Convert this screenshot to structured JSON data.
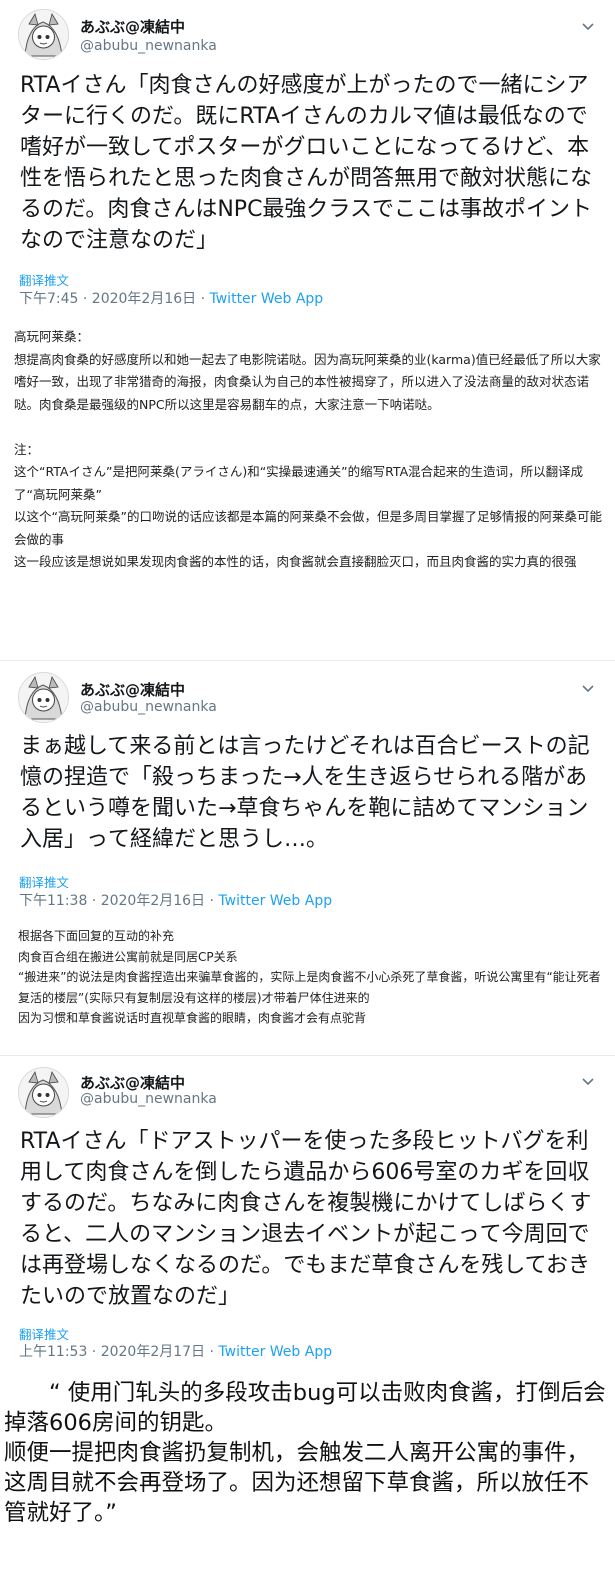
{
  "tweets": [
    {
      "display_name": "あぶぶ@凍結中",
      "handle": "@abubu_newnanka",
      "text": "RTAイさん「肉食さんの好感度が上がったので一緒にシアターに行くのだ。既にRTAイさんのカルマ値は最低なので嗜好が一致してポスターがグロいことになってるけど、本性を悟られたと思った肉食さんが問答無用で敵対状態になるのだ。肉食さんはNPC最強クラスでここは事故ポイントなので注意なのだ」",
      "translate_label": "翻译推文",
      "timestamp": "下午7:45 · 2020年2月16日",
      "separator": " · ",
      "app": "Twitter Web App"
    },
    {
      "display_name": "あぶぶ@凍結中",
      "handle": "@abubu_newnanka",
      "text": "まぁ越して来る前とは言ったけどそれは百合ビーストの記憶の捏造で「殺っちまった→人を生き返らせられる階があるという噂を聞いた→草食ちゃんを鞄に詰めてマンション入居」って経緯だと思うし…。",
      "translate_label": "翻译推文",
      "timestamp": "下午11:38 · 2020年2月16日",
      "separator": " · ",
      "app": "Twitter Web App"
    },
    {
      "display_name": "あぶぶ@凍結中",
      "handle": "@abubu_newnanka",
      "text": "RTAイさん「ドアストッパーを使った多段ヒットバグを利用して肉食さんを倒したら遺品から606号室のカギを回収するのだ。ちなみに肉食さんを複製機にかけてしばらくすると、二人のマンション退去イベントが起こって今周回では再登場しなくなるのだ。でもまだ草食さんを残しておきたいので放置なのだ」",
      "translate_label": "翻译推文",
      "timestamp": "上午11:53 · 2020年2月17日",
      "separator": " · ",
      "app": "Twitter Web App"
    }
  ],
  "notes1": [
    "高玩阿莱桑：",
    "想提高肉食桑的好感度所以和她一起去了电影院诺哒。因为高玩阿莱桑的业(karma)值已经最低了所以大家嗜好一致，出现了非常猎奇的海报，肉食桑认为自己的本性被揭穿了，所以进入了没法商量的敌对状态诺哒。肉食桑是最强级的NPC所以这里是容易翻车的点，大家注意一下呐诺哒。",
    "",
    "注：",
    "这个“RTAイさん”是把阿莱桑(アライさん)和“实操最速通关”的缩写RTA混合起来的生造词，所以翻译成了“高玩阿莱桑”",
    "以这个“高玩阿莱桑”的口吻说的话应该都是本篇的阿莱桑不会做，但是多周目掌握了足够情报的阿莱桑可能会做的事",
    "这一段应该是想说如果发现肉食酱的本性的话，肉食酱就会直接翻脸灭口，而且肉食酱的实力真的很强"
  ],
  "notes2": [
    "根据各下面回复的互动的补充",
    "肉食百合组在搬进公寓前就是同居CP关系",
    "“搬进来”的说法是肉食酱捏造出来骗草食酱的，实际上是肉食酱不小心杀死了草食酱，听说公寓里有“能让死者复活的楼层”(实际只有复制层没有这样的楼层)才带着尸体住进来的",
    "因为习惯和草食酱说话时直视草食酱的眼睛，肉食酱才会有点驼背"
  ],
  "final_translation": [
    "　　“ 使用门轧头的多段攻击bug可以击败肉食酱，打倒后会掉落606房间的钥匙。",
    "顺便一提把肉食酱扔复制机，会触发二人离开公寓的事件，这周目就不会再登场了。因为还想留下草食酱，所以放任不管就好了。”"
  ],
  "colors": {
    "link": "#1da1f2",
    "secondary_text": "#657786",
    "primary_text": "#14171a"
  },
  "icons": {
    "avatar": "anime-character-avatar",
    "caret": "chevron-down-icon"
  }
}
